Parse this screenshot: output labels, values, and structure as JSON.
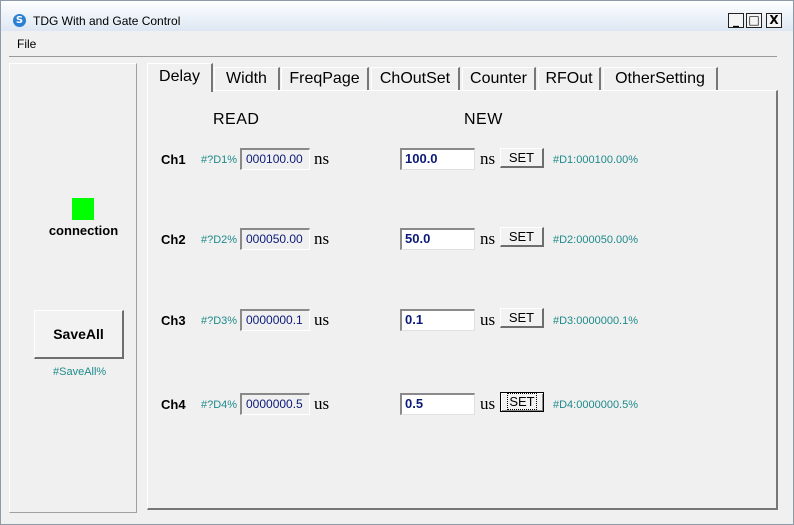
{
  "window": {
    "title": "TDG With and Gate Control",
    "min": "_",
    "max": "□",
    "close": "X"
  },
  "menu": {
    "file": "File"
  },
  "left": {
    "status_label": "connection",
    "status_color": "#00ff00",
    "save_label": "SaveAll",
    "save_cmd": "#SaveAll%"
  },
  "tabs": [
    "Delay",
    "Width",
    "FreqPage",
    "ChOutSet",
    "Counter",
    "RFOut",
    "OtherSetting"
  ],
  "headers": {
    "read": "READ",
    "new": "NEW"
  },
  "set_label": "SET",
  "channels": [
    {
      "label": "Ch1",
      "query": "#?D1%",
      "read": "000100.00",
      "read_unit": "ns",
      "new": "100.0",
      "new_unit": "ns",
      "set_cmd": "#D1:000100.00%"
    },
    {
      "label": "Ch2",
      "query": "#?D2%",
      "read": "000050.00",
      "read_unit": "ns",
      "new": "50.0",
      "new_unit": "ns",
      "set_cmd": "#D2:000050.00%"
    },
    {
      "label": "Ch3",
      "query": "#?D3%",
      "read": "0000000.1",
      "read_unit": "us",
      "new": "0.1",
      "new_unit": "us",
      "set_cmd": "#D3:0000000.1%"
    },
    {
      "label": "Ch4",
      "query": "#?D4%",
      "read": "0000000.5",
      "read_unit": "us",
      "new": "0.5",
      "new_unit": "us",
      "set_cmd": "#D4:0000000.5%"
    }
  ]
}
